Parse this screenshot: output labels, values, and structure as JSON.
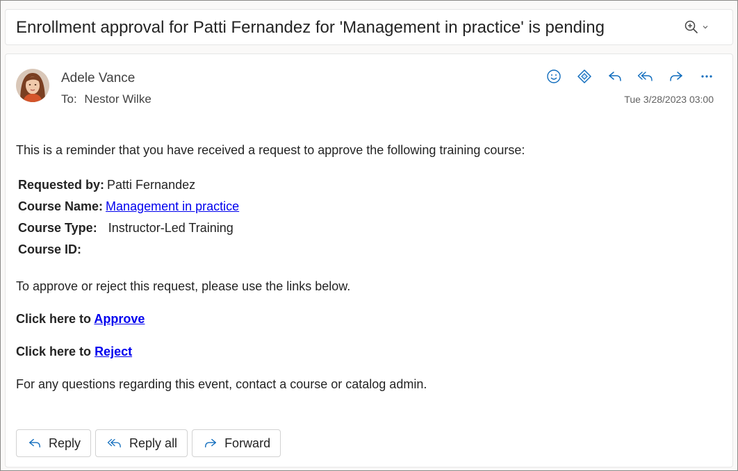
{
  "subject": "Enrollment approval for Patti Fernandez for 'Management in practice' is pending",
  "header": {
    "sender": "Adele Vance",
    "to_label": "To:",
    "to": "Nestor Wilke",
    "date": "Tue 3/28/2023 03:00",
    "actions": [
      "smiley-icon",
      "loop-icon",
      "reply-icon",
      "reply-all-icon",
      "forward-icon",
      "more-icon"
    ]
  },
  "body": {
    "intro": "This is a reminder that you have received a request to approve the following training course:",
    "details": {
      "requested_by_label": "Requested by:",
      "requested_by": "Patti Fernandez",
      "course_name_label": "Course Name:",
      "course_name": "Management in practice",
      "course_type_label": "Course Type:",
      "course_type": "Instructor-Led Training",
      "course_id_label": "Course ID:"
    },
    "instructions": "To approve or reject this request, please use the links below.",
    "approve_prefix": "Click here to",
    "approve_link": "Approve",
    "reject_prefix": "Click here to",
    "reject_link": "Reject",
    "footer_note": "For any questions regarding this event, contact a course or catalog admin."
  },
  "footer_buttons": {
    "reply": "Reply",
    "reply_all": "Reply all",
    "forward": "Forward"
  },
  "colors": {
    "accent": "#0f6cbd",
    "link": "#0000ee"
  }
}
